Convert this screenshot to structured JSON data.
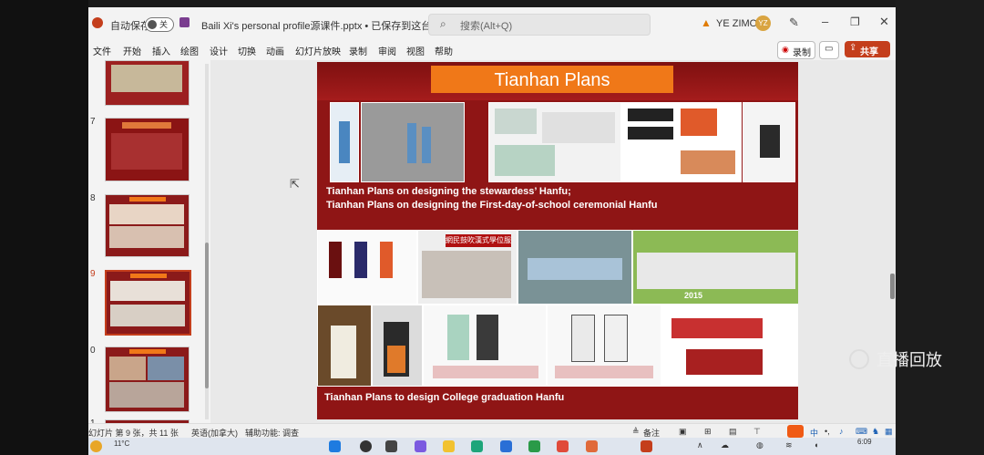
{
  "window": {
    "autosave_label": "自动保存",
    "autosave_state": "关",
    "file_title": "Baili Xi's personal profile源课件.pptx • 已保存到这台电脑",
    "search_placeholder": "搜索(Alt+Q)",
    "user_name": "YE ZIMO",
    "user_initials": "YZ"
  },
  "ribbon": {
    "tabs": [
      "文件",
      "开始",
      "插入",
      "绘图",
      "设计",
      "切换",
      "动画",
      "幻灯片放映",
      "录制",
      "审阅",
      "视图",
      "帮助"
    ],
    "record_label": "录制",
    "share_label": "共享"
  },
  "thumbnails": {
    "numbers": [
      "7",
      "8",
      "9",
      "0",
      "1"
    ]
  },
  "slide": {
    "title": "Tianhan Plans",
    "caption1_line1": "Tianhan Plans on designing the stewardess’ Hanfu;",
    "caption1_line2": "Tianhan Plans on designing the First-day-of-school ceremonial Hanfu",
    "caption2": "Tianhan Plans to design College graduation Hanfu",
    "newspaper_headline": "網民鼓吹漢式學位服",
    "year_label": "2015"
  },
  "status": {
    "slide_count": "幻灯片 第 9 张，共 11 张",
    "language": "英语(加拿大)",
    "accessibility": "辅助功能: 调查",
    "notes_label": "备注"
  },
  "taskbar": {
    "temperature": "11°C",
    "time": "6:09"
  },
  "overlay": {
    "replay_label": "直播回放"
  },
  "colors": {
    "slide_bg": "#8f1515",
    "title_box": "#f07818",
    "share_button": "#c43e1c"
  }
}
